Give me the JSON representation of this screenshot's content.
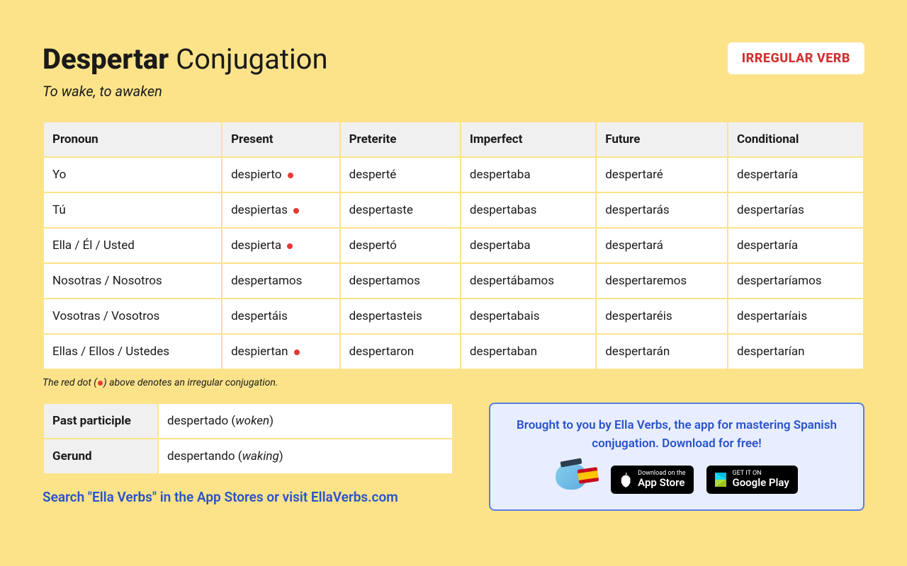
{
  "header": {
    "verb": "Despertar",
    "title_suffix": "Conjugation",
    "subtitle": "To wake, to awaken",
    "badge": "IRREGULAR VERB"
  },
  "columns": [
    "Pronoun",
    "Present",
    "Preterite",
    "Imperfect",
    "Future",
    "Conditional"
  ],
  "rows": [
    {
      "pronoun": "Yo",
      "present": "despierto",
      "present_irregular": true,
      "preterite": "desperté",
      "imperfect": "despertaba",
      "future": "despertaré",
      "conditional": "despertaría"
    },
    {
      "pronoun": "Tú",
      "present": "despiertas",
      "present_irregular": true,
      "preterite": "despertaste",
      "imperfect": "despertabas",
      "future": "despertarás",
      "conditional": "despertarías"
    },
    {
      "pronoun": "Ella / Él / Usted",
      "present": "despierta",
      "present_irregular": true,
      "preterite": "despertó",
      "imperfect": "despertaba",
      "future": "despertará",
      "conditional": "despertaría"
    },
    {
      "pronoun": "Nosotras / Nosotros",
      "present": "despertamos",
      "present_irregular": false,
      "preterite": "despertamos",
      "imperfect": "despertábamos",
      "future": "despertaremos",
      "conditional": "despertaríamos"
    },
    {
      "pronoun": "Vosotras / Vosotros",
      "present": "despertáis",
      "present_irregular": false,
      "preterite": "despertasteis",
      "imperfect": "despertabais",
      "future": "despertaréis",
      "conditional": "despertaríais"
    },
    {
      "pronoun": "Ellas / Ellos / Ustedes",
      "present": "despiertan",
      "present_irregular": true,
      "preterite": "despertaron",
      "imperfect": "despertaban",
      "future": "despertarán",
      "conditional": "despertarían"
    }
  ],
  "footnote_prefix": "The red dot (",
  "footnote_suffix": ") above denotes an irregular conjugation.",
  "forms": {
    "past_participle_label": "Past participle",
    "past_participle_value": "despertado",
    "past_participle_translation": "woken",
    "gerund_label": "Gerund",
    "gerund_value": "despertando",
    "gerund_translation": "waking"
  },
  "search_line": "Search \"Ella Verbs\" in the App Stores or visit EllaVerbs.com",
  "promo": {
    "text": "Brought to you by Ella Verbs, the app for mastering Spanish conjugation. Download for free!",
    "app_store_small": "Download on the",
    "app_store_big": "App Store",
    "google_play_small": "GET IT ON",
    "google_play_big": "Google Play"
  }
}
